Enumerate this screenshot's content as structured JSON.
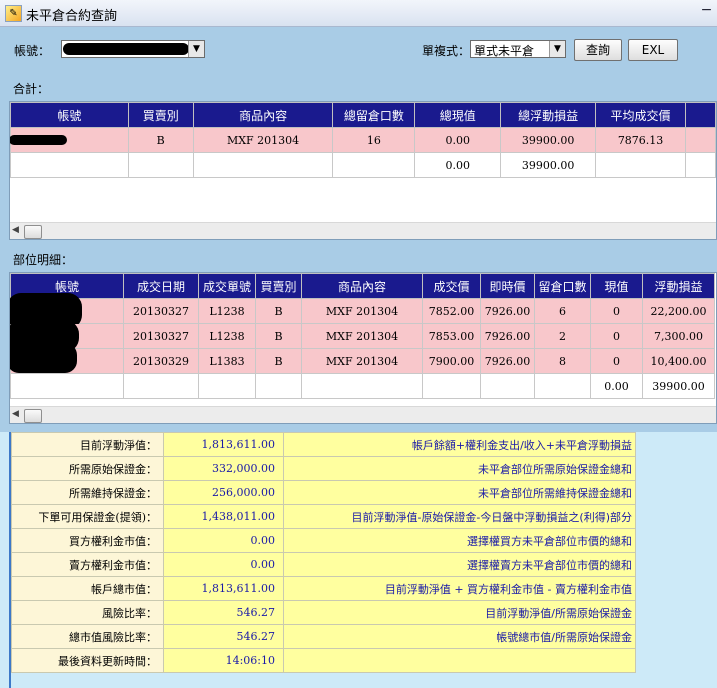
{
  "window": {
    "title": "未平倉合約查詢",
    "min_glyph": "−"
  },
  "toolbar": {
    "account_label": "帳號：",
    "mode_label": "單複式：",
    "mode_value": "單式未平倉",
    "query_button": "查詢",
    "export_button": "EXL"
  },
  "total": {
    "label": "合計：",
    "columns": [
      "帳號",
      "買賣別",
      "商品內容",
      "總留倉口數",
      "總現值",
      "總浮動損益",
      "平均成交價",
      ""
    ],
    "rows": [
      [
        "",
        "B",
        "MXF 201304",
        "16",
        "0.00",
        "39900.00",
        "7876.13",
        ""
      ],
      [
        "",
        "",
        "",
        "",
        "0.00",
        "39900.00",
        "",
        ""
      ]
    ]
  },
  "detail": {
    "label": "部位明細：",
    "columns": [
      "帳號",
      "成交日期",
      "成交單號",
      "買賣別",
      "商品內容",
      "成交價",
      "即時價",
      "留倉口數",
      "現值",
      "浮動損益"
    ],
    "rows": [
      [
        "",
        "20130327",
        "L1238",
        "B",
        "MXF 201304",
        "7852.00",
        "7926.00",
        "6",
        "0",
        "22,200.00"
      ],
      [
        "",
        "20130327",
        "L1238",
        "B",
        "MXF 201304",
        "7853.00",
        "7926.00",
        "2",
        "0",
        "7,300.00"
      ],
      [
        "",
        "20130329",
        "L1383",
        "B",
        "MXF 201304",
        "7900.00",
        "7926.00",
        "8",
        "0",
        "10,400.00"
      ],
      [
        "",
        "",
        "",
        "",
        "",
        "",
        "",
        "",
        "0.00",
        "39900.00"
      ]
    ]
  },
  "summary": [
    {
      "label": "目前浮動淨值：",
      "value": "1,813,611.00",
      "desc": "帳戶餘額+權利金支出/收入+未平倉浮動損益"
    },
    {
      "label": "所需原始保證金：",
      "value": "332,000.00",
      "desc": "未平倉部位所需原始保證金總和"
    },
    {
      "label": "所需維持保證金：",
      "value": "256,000.00",
      "desc": "未平倉部位所需維持保證金總和"
    },
    {
      "label": "下單可用保證金(提領)：",
      "value": "1,438,011.00",
      "desc": "目前浮動淨值-原始保證金-今日盤中浮動損益之(利得)部分"
    },
    {
      "label": "買方權利金市值：",
      "value": "0.00",
      "desc": "選擇權買方未平倉部位市價的總和"
    },
    {
      "label": "賣方權利金市值：",
      "value": "0.00",
      "desc": "選擇權賣方未平倉部位市價的總和"
    },
    {
      "label": "帳戶總市值：",
      "value": "1,813,611.00",
      "desc": "目前浮動淨值 + 買方權利金市值 - 賣方權利金市值"
    },
    {
      "label": "風險比率：",
      "value": "546.27",
      "desc": "目前浮動淨值/所需原始保證金"
    },
    {
      "label": "總市值風險比率：",
      "value": "546.27",
      "desc": "帳號總市值/所需原始保證金"
    },
    {
      "label": "最後資料更新時間：",
      "value": "14:06:10",
      "desc": ""
    }
  ]
}
